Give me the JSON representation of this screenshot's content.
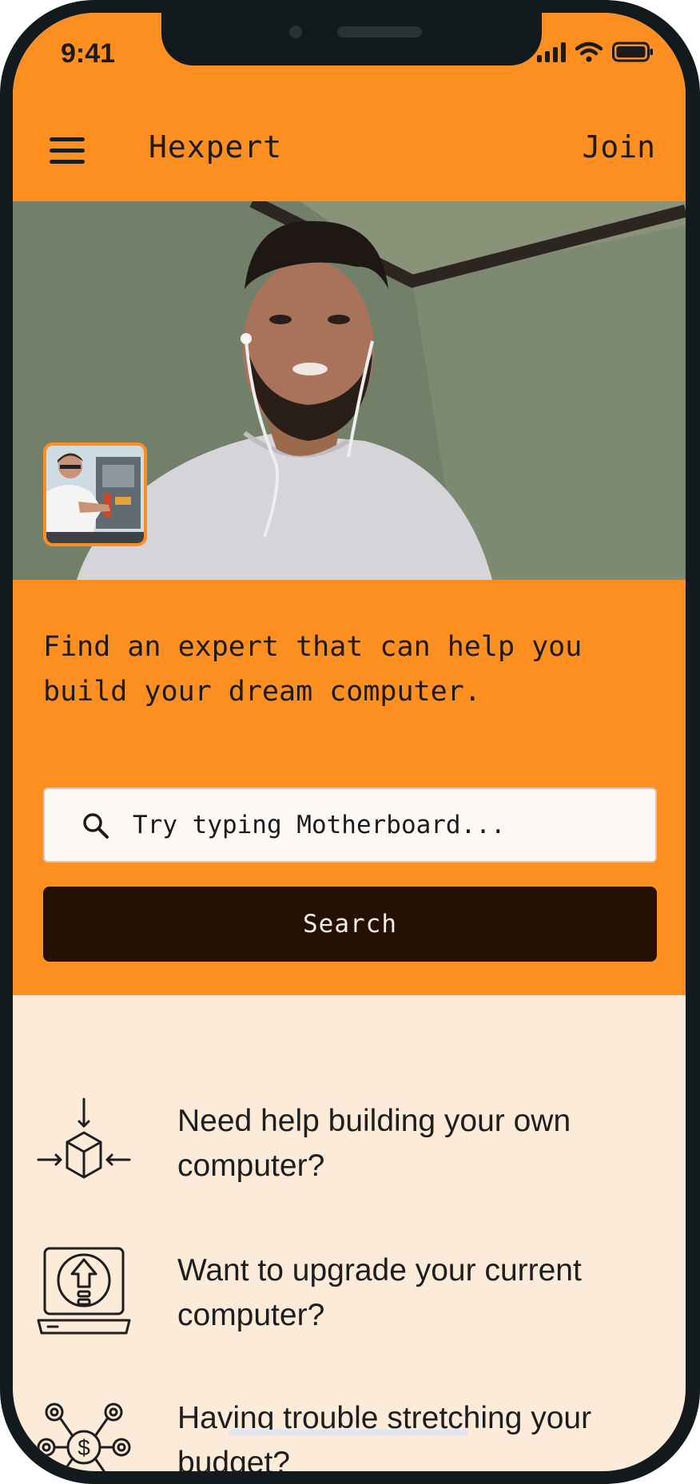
{
  "status_bar": {
    "time": "9:41",
    "icons": [
      "cellular-signal-icon",
      "wifi-icon",
      "battery-icon"
    ]
  },
  "header": {
    "menu_icon": "hamburger-menu-icon",
    "title": "Hexpert",
    "join_label": "Join"
  },
  "video_call": {
    "main_feed": "video-feed-expert",
    "pip_feed": "video-feed-self"
  },
  "hero": {
    "headline": "Find an expert that can help you build your dream computer.",
    "search_placeholder": "Try typing Motherboard...",
    "search_button_label": "Search"
  },
  "features": [
    {
      "icon": "build-computer-icon",
      "text": "Need help building your own computer?"
    },
    {
      "icon": "upgrade-computer-icon",
      "text": "Want to upgrade your current computer?"
    },
    {
      "icon": "budget-icon",
      "text": "Having trouble stretching your budget?"
    }
  ],
  "colors": {
    "accent": "#fd8f21",
    "dark_button": "#251103",
    "content_background": "#fcebd9",
    "text": "#1b1b1b"
  }
}
